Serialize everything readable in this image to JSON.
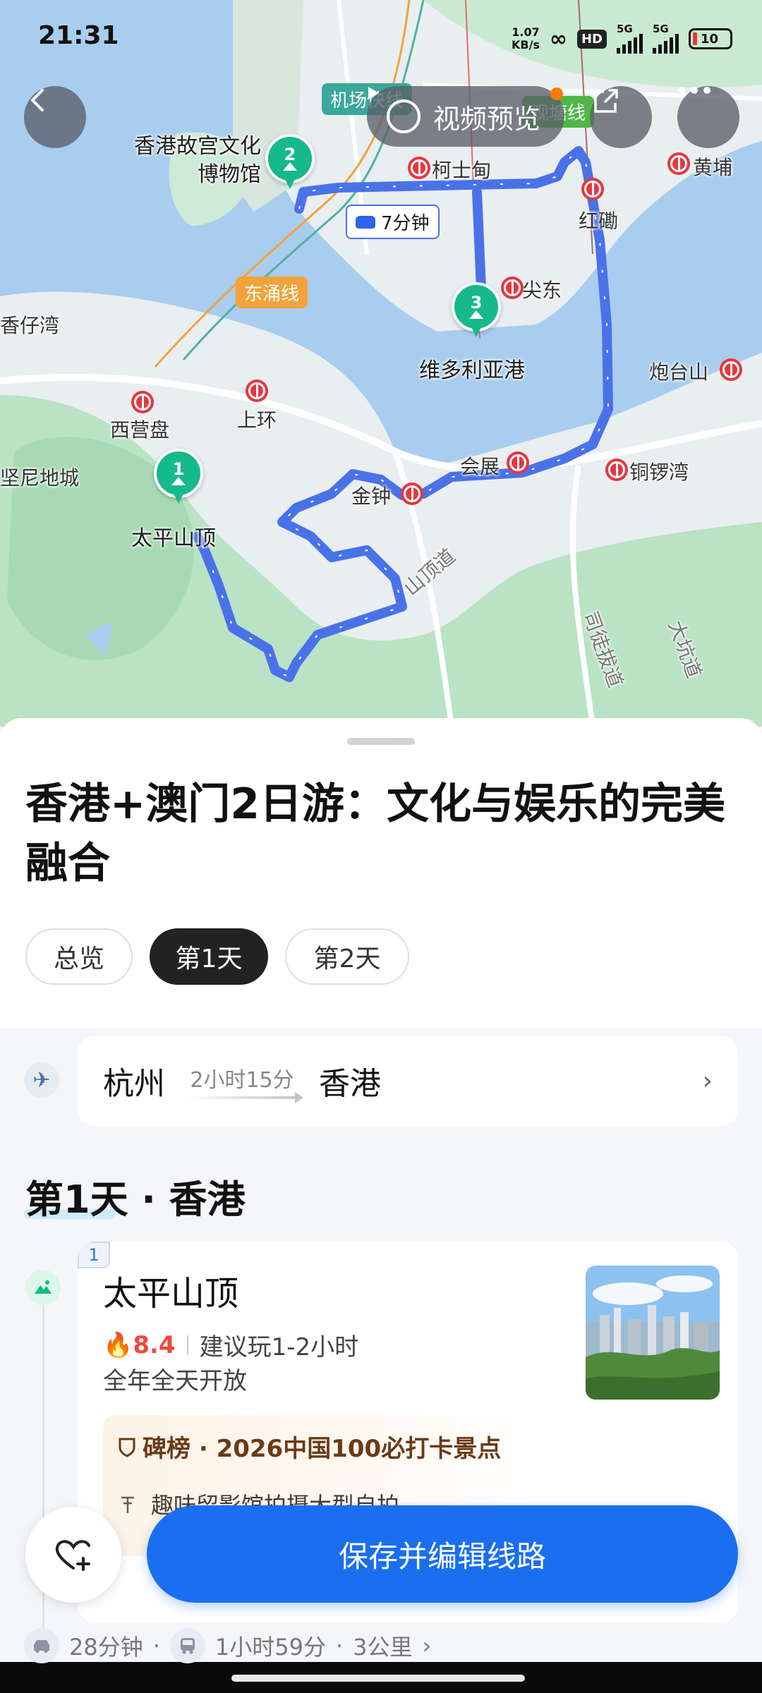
{
  "status": {
    "time": "21:31",
    "net_speed_value": "1.07",
    "net_speed_unit": "KB/s",
    "hd": "HD",
    "sim1": "5G",
    "sim2": "5G",
    "battery": "10"
  },
  "map": {
    "video_preview_label": "视频预览",
    "drive_time": "7分钟",
    "lines": {
      "airport_express": "机场快线",
      "tung_chung": "东涌线",
      "tsuen_wan": "观塘线"
    },
    "places": {
      "palace_museum": "香港故宫文化博物馆",
      "victoria_harbour": "维多利亚港",
      "the_peak": "太平山顶",
      "sai_ying_pun": "西营盘",
      "sheung_wan": "上环",
      "admiralty": "金钟",
      "convention": "会展",
      "causeway_bay": "铜锣湾",
      "fortress_hill": "炮台山",
      "tsim_sha_tsui": "尖东",
      "austin": "柯士甸",
      "hung_hom": "红磡",
      "whampoa": "黄埔",
      "kennedy": "坚尼地城",
      "west_kowloon": "香仔湾",
      "peak_road": "山顶道",
      "stubbs_road": "司徒拔道",
      "tai_hang": "大坑道"
    },
    "pins": [
      {
        "num": "1"
      },
      {
        "num": "2"
      },
      {
        "num": "3"
      }
    ]
  },
  "sheet": {
    "title": "香港+澳门2日游：文化与娱乐的完美融合",
    "tabs": [
      {
        "label": "总览",
        "active": false
      },
      {
        "label": "第1天",
        "active": true
      },
      {
        "label": "第2天",
        "active": false
      }
    ],
    "flight": {
      "from": "杭州",
      "duration": "2小时15分",
      "to": "香港"
    },
    "day_heading": "第1天 · 香港",
    "spot": {
      "num": "1",
      "name": "太平山顶",
      "score": "8.4",
      "suggest": "建议玩1-2小时",
      "hours": "全年全天开放",
      "rank": "碑榜 · 2026中国100必打卡景点",
      "highlight": "趣味留影馆拍摄大型自拍"
    },
    "save_button": "保存并编辑线路",
    "transit": {
      "drive": "28分钟",
      "bus": "1小时59分",
      "distance": "3公里"
    }
  },
  "colors": {
    "accent": "#1a6ff0",
    "route": "#4a72e8",
    "pin": "#16b98a",
    "mtr": "#e4373f"
  }
}
